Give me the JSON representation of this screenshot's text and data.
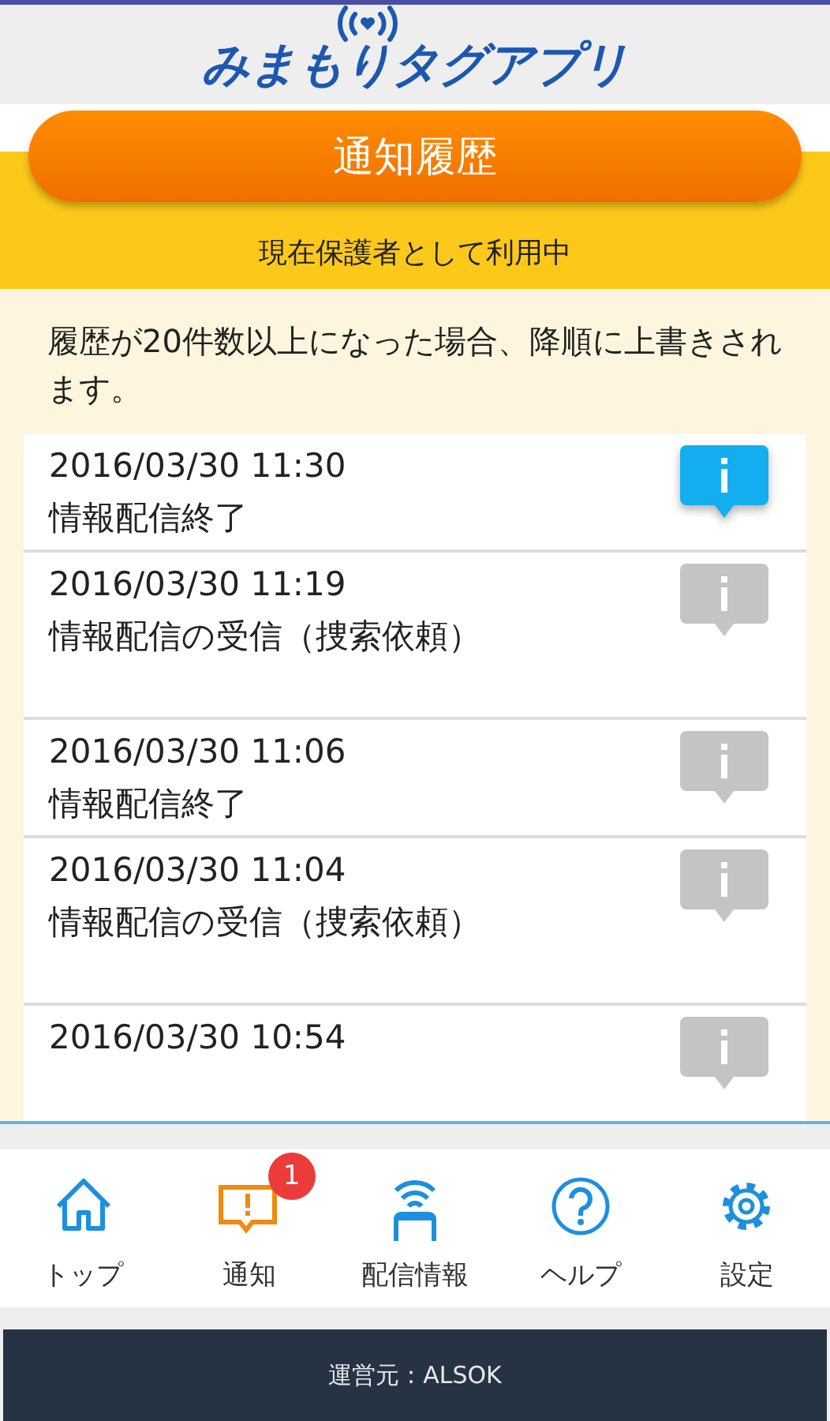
{
  "header": {
    "logo": "みまもりタグアプリ"
  },
  "title_button": "通知履歴",
  "status": "現在保護者として利用中",
  "note": "履歴が20件数以上になった場合、降順に上書きされます。",
  "history": [
    {
      "datetime": "2016/03/30 11:30",
      "message": "情報配信終了",
      "selected": true,
      "kind": "short"
    },
    {
      "datetime": "2016/03/30 11:19",
      "message": "情報配信の受信（捜索依頼）",
      "selected": false,
      "kind": "tall"
    },
    {
      "datetime": "2016/03/30 11:06",
      "message": "情報配信終了",
      "selected": false,
      "kind": "short"
    },
    {
      "datetime": "2016/03/30 11:04",
      "message": "情報配信の受信（捜索依頼）",
      "selected": false,
      "kind": "tall"
    },
    {
      "datetime": "2016/03/30 10:54",
      "selected": false,
      "kind": "short"
    }
  ],
  "tabs": [
    {
      "label": "トップ",
      "kind": "home",
      "selected": false
    },
    {
      "label": "通知",
      "kind": "notice",
      "selected": true,
      "badge": "1"
    },
    {
      "label": "配信情報",
      "kind": "broadcast",
      "selected": false
    },
    {
      "label": "ヘルプ",
      "kind": "help",
      "selected": false
    },
    {
      "label": "設定",
      "kind": "settings",
      "selected": false
    }
  ],
  "footer": "運営元：ALSOK"
}
